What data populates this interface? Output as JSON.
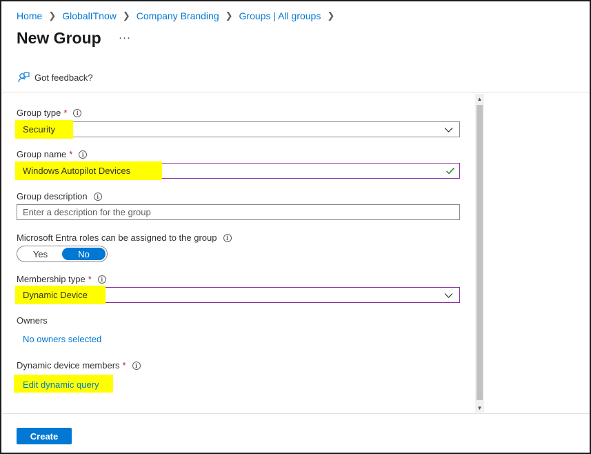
{
  "breadcrumb": [
    {
      "label": "Home"
    },
    {
      "label": "GlobalITnow"
    },
    {
      "label": "Company Branding"
    },
    {
      "label": "Groups | All groups"
    }
  ],
  "page": {
    "title": "New Group",
    "more": "···"
  },
  "commandbar": {
    "feedback_label": "Got feedback?"
  },
  "form": {
    "group_type": {
      "label": "Group type",
      "required": "*",
      "value": "Security"
    },
    "group_name": {
      "label": "Group name",
      "required": "*",
      "value": "Windows Autopilot Devices"
    },
    "group_description": {
      "label": "Group description",
      "placeholder": "Enter a description for the group"
    },
    "entra_roles": {
      "label": "Microsoft Entra roles can be assigned to the group",
      "options": [
        "Yes",
        "No"
      ],
      "selected": "No"
    },
    "membership_type": {
      "label": "Membership type",
      "required": "*",
      "value": "Dynamic Device"
    },
    "owners": {
      "label": "Owners",
      "link": "No owners selected"
    },
    "dynamic_members": {
      "label": "Dynamic device members",
      "required": "*",
      "link": "Edit dynamic query"
    }
  },
  "footer": {
    "create_label": "Create"
  },
  "colors": {
    "accent": "#0078d4",
    "highlight": "#ffff00",
    "required": "#a4262c",
    "focus_border": "#8a2da5",
    "valid_check": "#107c10"
  },
  "icons": {
    "feedback": "feedback-icon",
    "info": "info-icon",
    "chevron": "chevron-down-icon",
    "check": "checkmark-icon",
    "breadcrumb_separator": "chevron-right-icon"
  }
}
